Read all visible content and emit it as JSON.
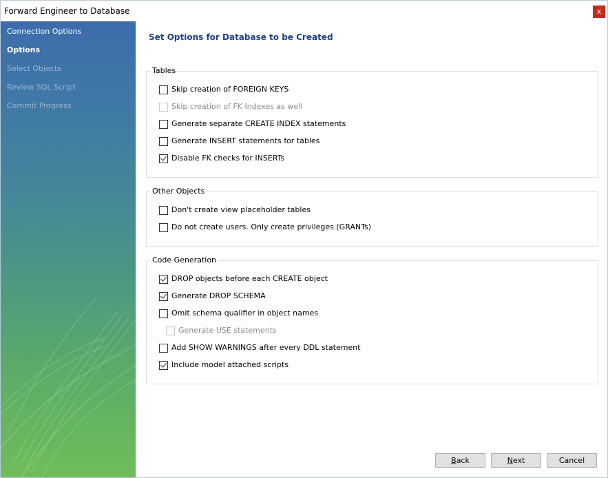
{
  "window": {
    "title": "Forward Engineer to Database",
    "close_glyph": "x"
  },
  "sidebar": {
    "items": [
      {
        "label": "Connection Options",
        "state": "done"
      },
      {
        "label": "Options",
        "state": "current"
      },
      {
        "label": "Select Objects",
        "state": "pending"
      },
      {
        "label": "Review SQL Script",
        "state": "pending"
      },
      {
        "label": "Commit Progress",
        "state": "pending"
      }
    ]
  },
  "main": {
    "heading": "Set Options for Database to be Created",
    "groups": [
      {
        "legend": "Tables",
        "options": [
          {
            "label": "Skip creation of FOREIGN KEYS",
            "checked": false,
            "disabled": false
          },
          {
            "label": "Skip creation of FK Indexes as well",
            "checked": false,
            "disabled": true
          },
          {
            "label": "Generate separate CREATE INDEX statements",
            "checked": false,
            "disabled": false
          },
          {
            "label": "Generate INSERT statements for tables",
            "checked": false,
            "disabled": false
          },
          {
            "label": "Disable FK checks for INSERTs",
            "checked": true,
            "disabled": false
          }
        ]
      },
      {
        "legend": "Other Objects",
        "options": [
          {
            "label": "Don't create view placeholder tables",
            "checked": false,
            "disabled": false
          },
          {
            "label": "Do not create users. Only create privileges (GRANTs)",
            "checked": false,
            "disabled": false
          }
        ]
      },
      {
        "legend": "Code Generation",
        "options": [
          {
            "label": "DROP objects before each CREATE object",
            "checked": true,
            "disabled": false
          },
          {
            "label": "Generate DROP SCHEMA",
            "checked": true,
            "disabled": false
          },
          {
            "label": "Omit schema qualifier in object names",
            "checked": false,
            "disabled": false
          },
          {
            "label": "Generate USE statements",
            "checked": false,
            "disabled": true
          },
          {
            "label": "Add SHOW WARNINGS after every DDL statement",
            "checked": false,
            "disabled": false
          },
          {
            "label": "Include model attached scripts",
            "checked": true,
            "disabled": false
          }
        ]
      }
    ]
  },
  "buttons": {
    "back": {
      "first": "B",
      "rest": "ack"
    },
    "next": {
      "first": "N",
      "rest": "ext"
    },
    "cancel": "Cancel"
  },
  "colors": {
    "heading": "#1e3f8c",
    "close_button": "#c42b1c",
    "sidebar_top": "#3d6cac",
    "sidebar_bottom": "#6fbd5a"
  }
}
